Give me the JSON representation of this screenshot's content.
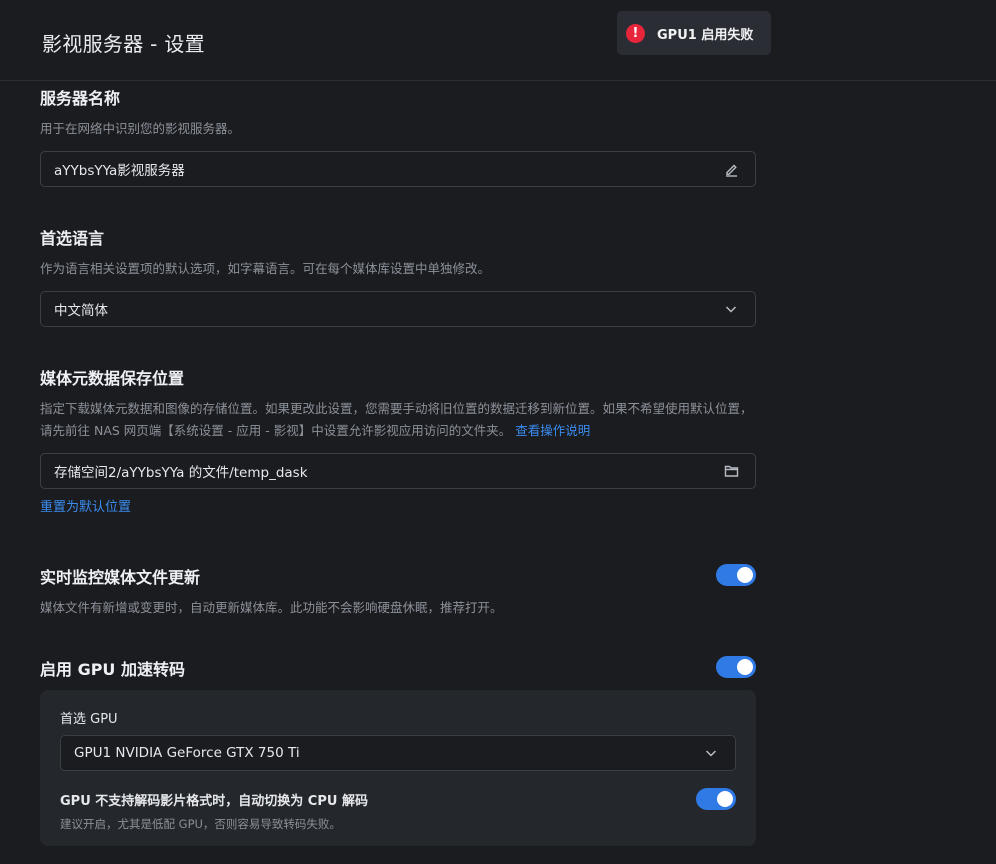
{
  "header": {
    "title": "影视服务器 - 设置"
  },
  "toast": {
    "icon": "error-icon",
    "message": "GPU1 启用失败",
    "color": "#e8263b"
  },
  "server_name": {
    "title": "服务器名称",
    "description": "用于在网络中识别您的影视服务器。",
    "value": "aYYbsYYa影视服务器",
    "icon": "edit-icon"
  },
  "language": {
    "title": "首选语言",
    "description": "作为语言相关设置项的默认选项，如字幕语言。可在每个媒体库设置中单独修改。",
    "value": "中文简体",
    "icon": "chevron-down-icon"
  },
  "metadata": {
    "title": "媒体元数据保存位置",
    "description": "指定下载媒体元数据和图像的存储位置。如果更改此设置，您需要手动将旧位置的数据迁移到新位置。如果不希望使用默认位置，请先前往 NAS 网页端【系统设置 - 应用 - 影视】中设置允许影视应用访问的文件夹。",
    "help_link": "查看操作说明",
    "value": "存储空间2/aYYbsYYa 的文件/temp_dask",
    "icon": "folder-icon",
    "reset_link": "重置为默认位置"
  },
  "monitor": {
    "title": "实时监控媒体文件更新",
    "description": "媒体文件有新增或变更时，自动更新媒体库。此功能不会影响硬盘休眠，推荐打开。",
    "enabled": true
  },
  "gpu": {
    "title": "启用 GPU 加速转码",
    "enabled": true,
    "preferred_label": "首选 GPU",
    "preferred_value": "GPU1 NVIDIA GeForce GTX 750 Ti",
    "fallback_label": "GPU 不支持解码影片格式时，自动切换为 CPU 解码",
    "fallback_desc": "建议开启，尤其是低配 GPU，否则容易导致转码失败。",
    "fallback_enabled": true
  },
  "colors": {
    "accent": "#2f7ae5",
    "link": "#3b8cf0",
    "background": "#1a1c20",
    "panel": "#24272c",
    "error": "#e8263b"
  }
}
